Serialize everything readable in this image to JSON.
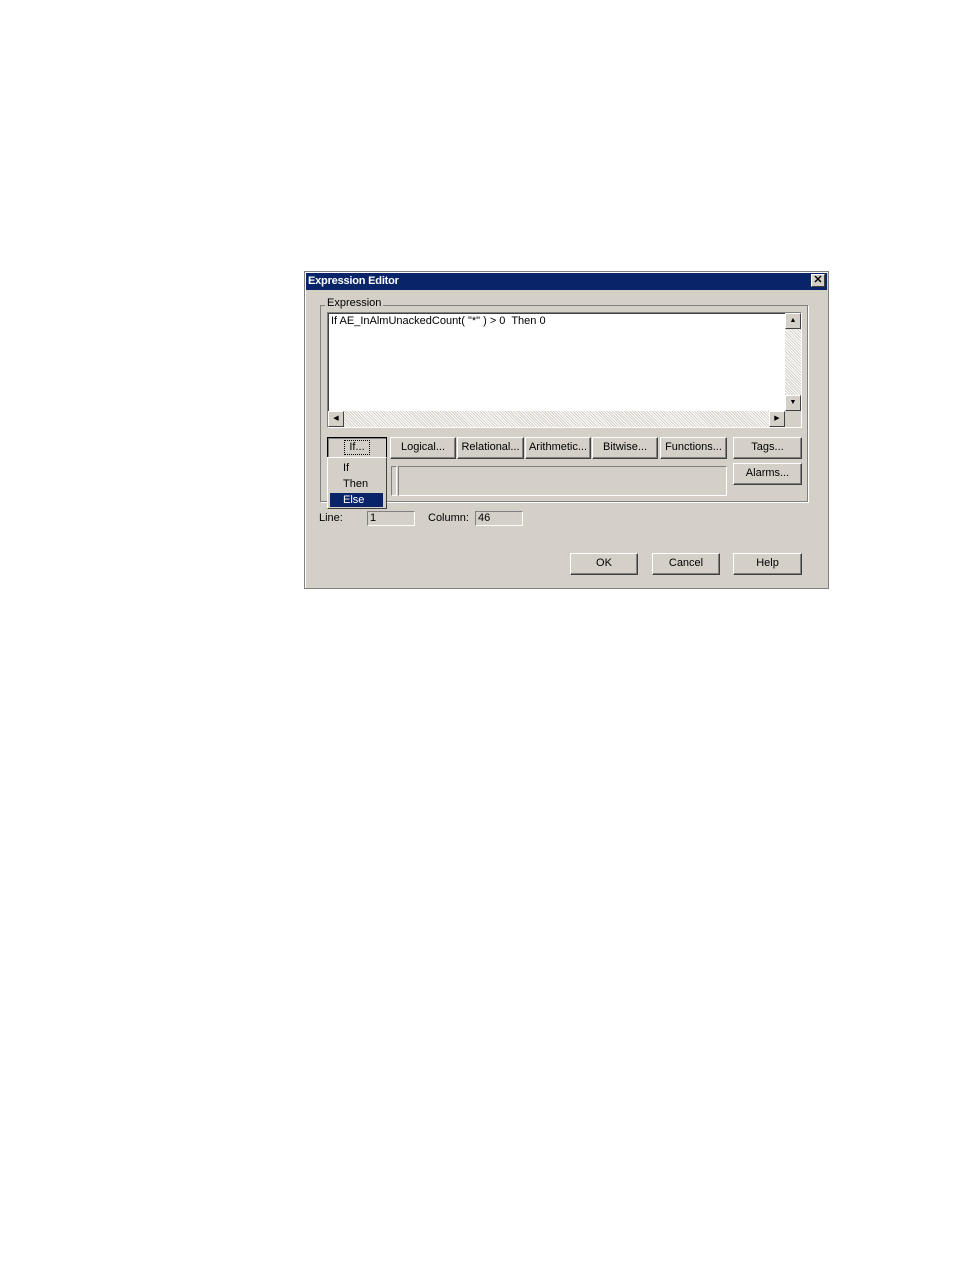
{
  "window": {
    "title": "Expression Editor",
    "close_glyph": "✕"
  },
  "expression": {
    "group_label": "Expression",
    "text": "If AE_InAlmUnackedCount( \"*\" ) > 0  Then 0"
  },
  "operators": {
    "if": "If...",
    "logical": "Logical...",
    "relational": "Relational...",
    "arithmetic": "Arithmetic...",
    "bitwise": "Bitwise...",
    "functions": "Functions...",
    "tags": "Tags...",
    "alarms": "Alarms..."
  },
  "if_menu": {
    "items": [
      "If",
      "Then",
      "Else"
    ],
    "selected": "Else"
  },
  "status": {
    "line_label": "Line:",
    "line_value": "1",
    "column_label": "Column:",
    "column_value": "46"
  },
  "footer": {
    "ok": "OK",
    "cancel": "Cancel",
    "help": "Help"
  },
  "colors": {
    "face": "#d4d0c8",
    "titlebar": "#0a246a",
    "selection": "#0a246a"
  },
  "icons": [
    "close-icon",
    "scroll-up-icon",
    "scroll-down-icon",
    "scroll-left-icon",
    "scroll-right-icon"
  ]
}
